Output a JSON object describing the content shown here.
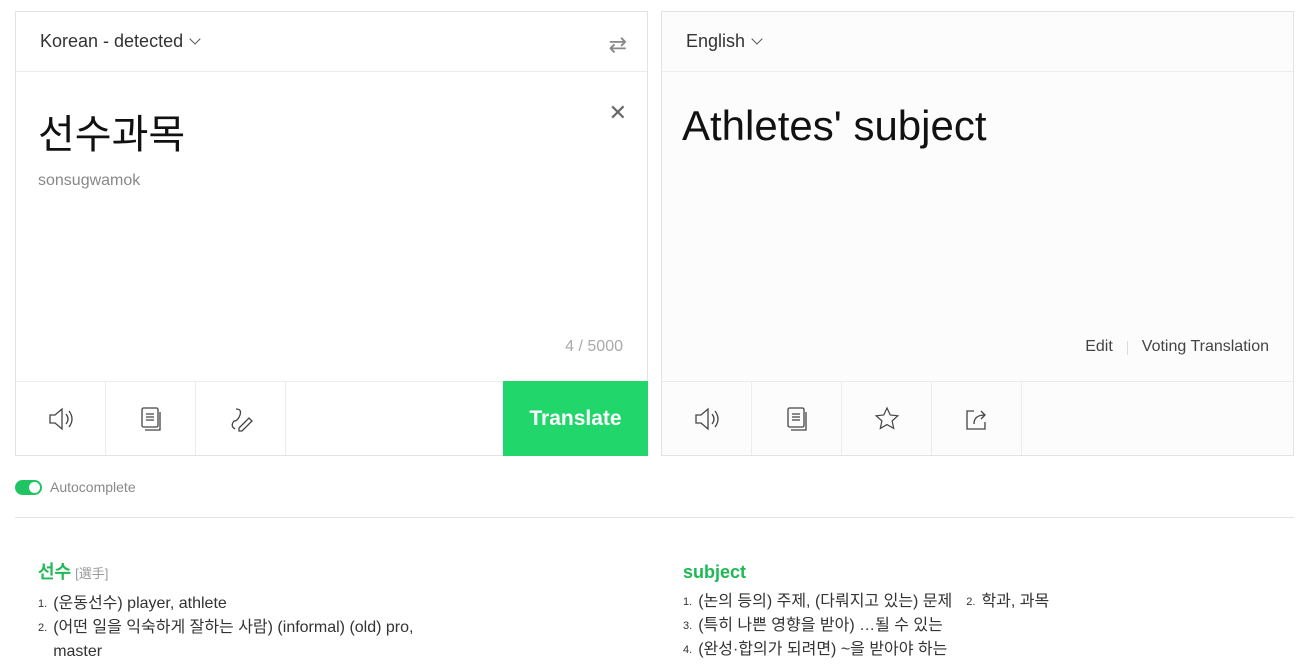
{
  "source": {
    "language": "Korean - detected",
    "text": "선수과목",
    "romanization": "sonsugwamok",
    "char_count": "4 / 5000",
    "translate_label": "Translate"
  },
  "target": {
    "language": "English",
    "text": "Athletes' subject",
    "edit_label": "Edit",
    "voting_label": "Voting Translation"
  },
  "autocomplete": {
    "label": "Autocomplete",
    "enabled": true
  },
  "dictionary": {
    "left": {
      "word": "선수",
      "hanja": "[選手]",
      "senses": [
        {
          "n": "1.",
          "text": "(운동선수) player, athlete"
        },
        {
          "n": "2.",
          "text": "(어떤 일을 익숙하게 잘하는 사람) (informal) (old) pro, master"
        }
      ]
    },
    "right": {
      "word": "subject",
      "senses": [
        {
          "n": "1.",
          "text": "(논의 등의) 주제, (다뤄지고 있는) 문제"
        },
        {
          "n": "2.",
          "text": "학과, 과목"
        },
        {
          "n": "3.",
          "text": "(특히 나쁜 영향을 받아) …될 수 있는"
        },
        {
          "n": "4.",
          "text": "(완성·합의가 되려면) ~을 받아야 하는"
        }
      ]
    }
  },
  "colors": {
    "accent": "#21d66b",
    "word": "#1db954"
  }
}
